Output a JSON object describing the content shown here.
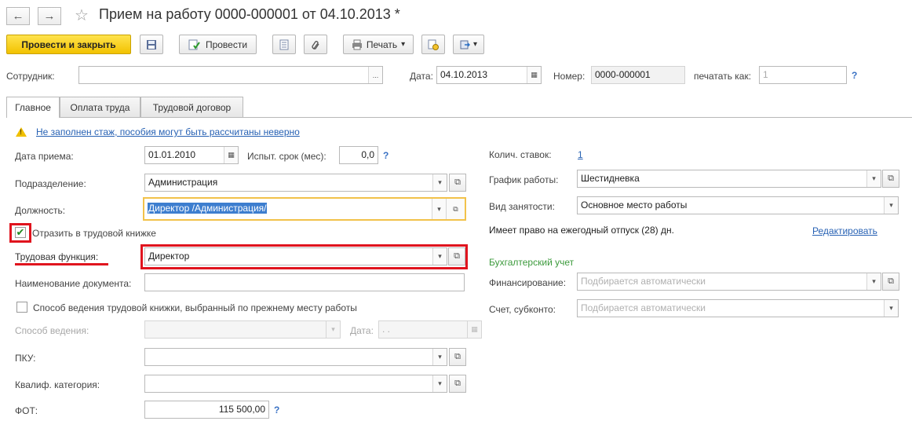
{
  "window": {
    "title": "Прием на работу 0000-000001 от 04.10.2013 *",
    "back_glyph": "←",
    "forward_glyph": "→",
    "favorite_glyph": "☆"
  },
  "toolbar": {
    "post_close_label": "Провести и закрыть",
    "post_label": "Провести",
    "print_label": "Печать",
    "dropdown_glyph": "▾"
  },
  "header": {
    "employee_label": "Сотрудник:",
    "employee_value": "",
    "date_label": "Дата:",
    "date_value": "04.10.2013",
    "number_label": "Номер:",
    "number_value": "0000-000001",
    "print_as_label": "печатать как:",
    "print_as_value": "1",
    "help": "?"
  },
  "tabs": [
    {
      "label": "Главное"
    },
    {
      "label": "Оплата труда"
    },
    {
      "label": "Трудовой договор"
    }
  ],
  "warning": {
    "text": "Не заполнен стаж, пособия могут быть рассчитаны неверно"
  },
  "left": {
    "hire_date_label": "Дата приема:",
    "hire_date_value": "01.01.2010",
    "trial_label": "Испыт. срок (мес):",
    "trial_value": "0,0",
    "dept_label": "Подразделение:",
    "dept_value": "Администрация",
    "position_label": "Должность:",
    "position_value": "Директор /Администрация/",
    "record_label": "Отразить в трудовой книжке",
    "labor_function_label": "Трудовая функция:",
    "labor_function_value": "Директор",
    "doc_name_label": "Наименование документа:",
    "doc_name_value": "",
    "method_prev_label": "Способ ведения трудовой книжки, выбранный по прежнему месту работы",
    "method_label": "Способ ведения:",
    "method_date_label": "Дата:",
    "method_date_value": " .  .",
    "pku_label": "ПКУ:",
    "qual_label": "Квалиф. категория:",
    "fot_label": "ФОТ:",
    "fot_value": "115 500,00"
  },
  "right": {
    "rates_label": "Колич. ставок:",
    "rates_value": "1",
    "schedule_label": "График работы:",
    "schedule_value": "Шестидневка",
    "employment_label": "Вид занятости:",
    "employment_value": "Основное место работы",
    "vacation_text": "Имеет право на ежегодный отпуск (28) дн.",
    "edit_link": "Редактировать",
    "accounting_head": "Бухгалтерский учет",
    "financing_label": "Финансирование:",
    "financing_placeholder": "Подбирается автоматически",
    "account_label": "Счет, субконто:",
    "account_placeholder": "Подбирается автоматически"
  },
  "glyphs": {
    "ellipsis": "...",
    "calendar": "▦",
    "open": "⧉",
    "check": "✔",
    "warn_mark": "!"
  },
  "colors": {
    "primary_button": "#f2c200",
    "highlight": "#e0141e",
    "link": "#2862b4",
    "accounting_head": "#3c9a3c"
  }
}
